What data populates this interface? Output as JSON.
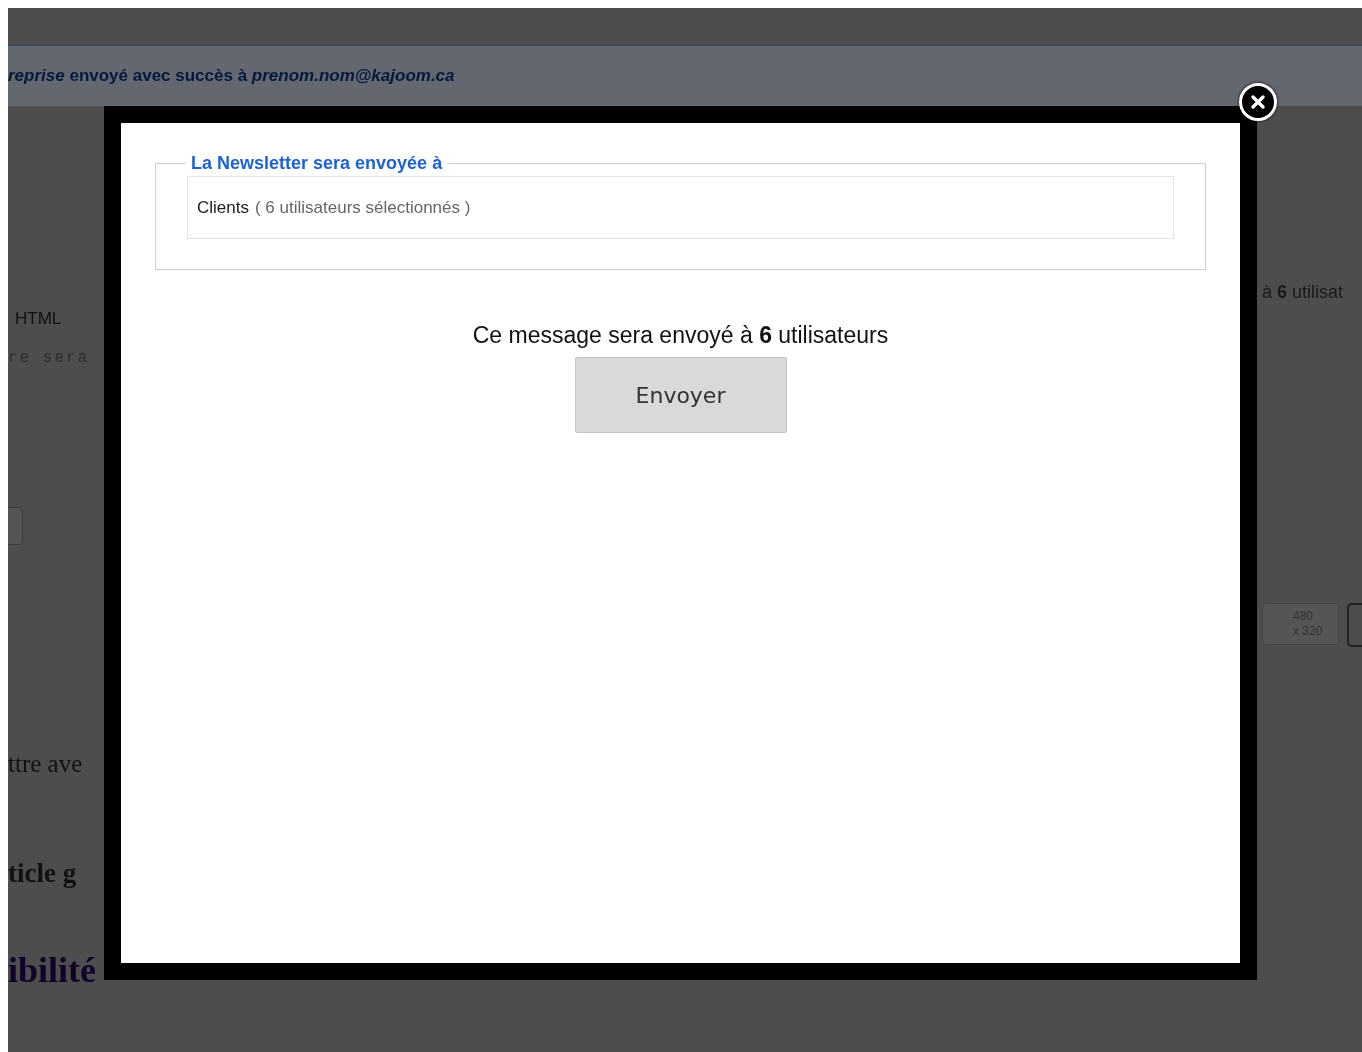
{
  "background": {
    "banner": "*reprise* envoyé avec succès à *prenom.nom@kajoom.ca*",
    "left_texts": [
      {
        "kind": "label",
        "text": "HTML"
      },
      {
        "kind": "code",
        "text": "re sera"
      },
      {
        "kind": "button"
      },
      {
        "kind": "body",
        "text": "ttre ave"
      },
      {
        "kind": "bold",
        "text": "ticle g"
      },
      {
        "kind": "heading",
        "text": "ibilité"
      }
    ],
    "right_summary": "à **6** utilisat",
    "size_button": {
      "line_1": "480",
      "line_2": "x 320"
    }
  },
  "modal": {
    "legend": "La Newsletter sera envoyée à",
    "recipient_group": "Clients",
    "recipient_count": "( 6 utilisateurs sélectionnés )",
    "message": "Ce message sera envoyé à **6** utilisateurs",
    "send_button": "Envoyer"
  }
}
